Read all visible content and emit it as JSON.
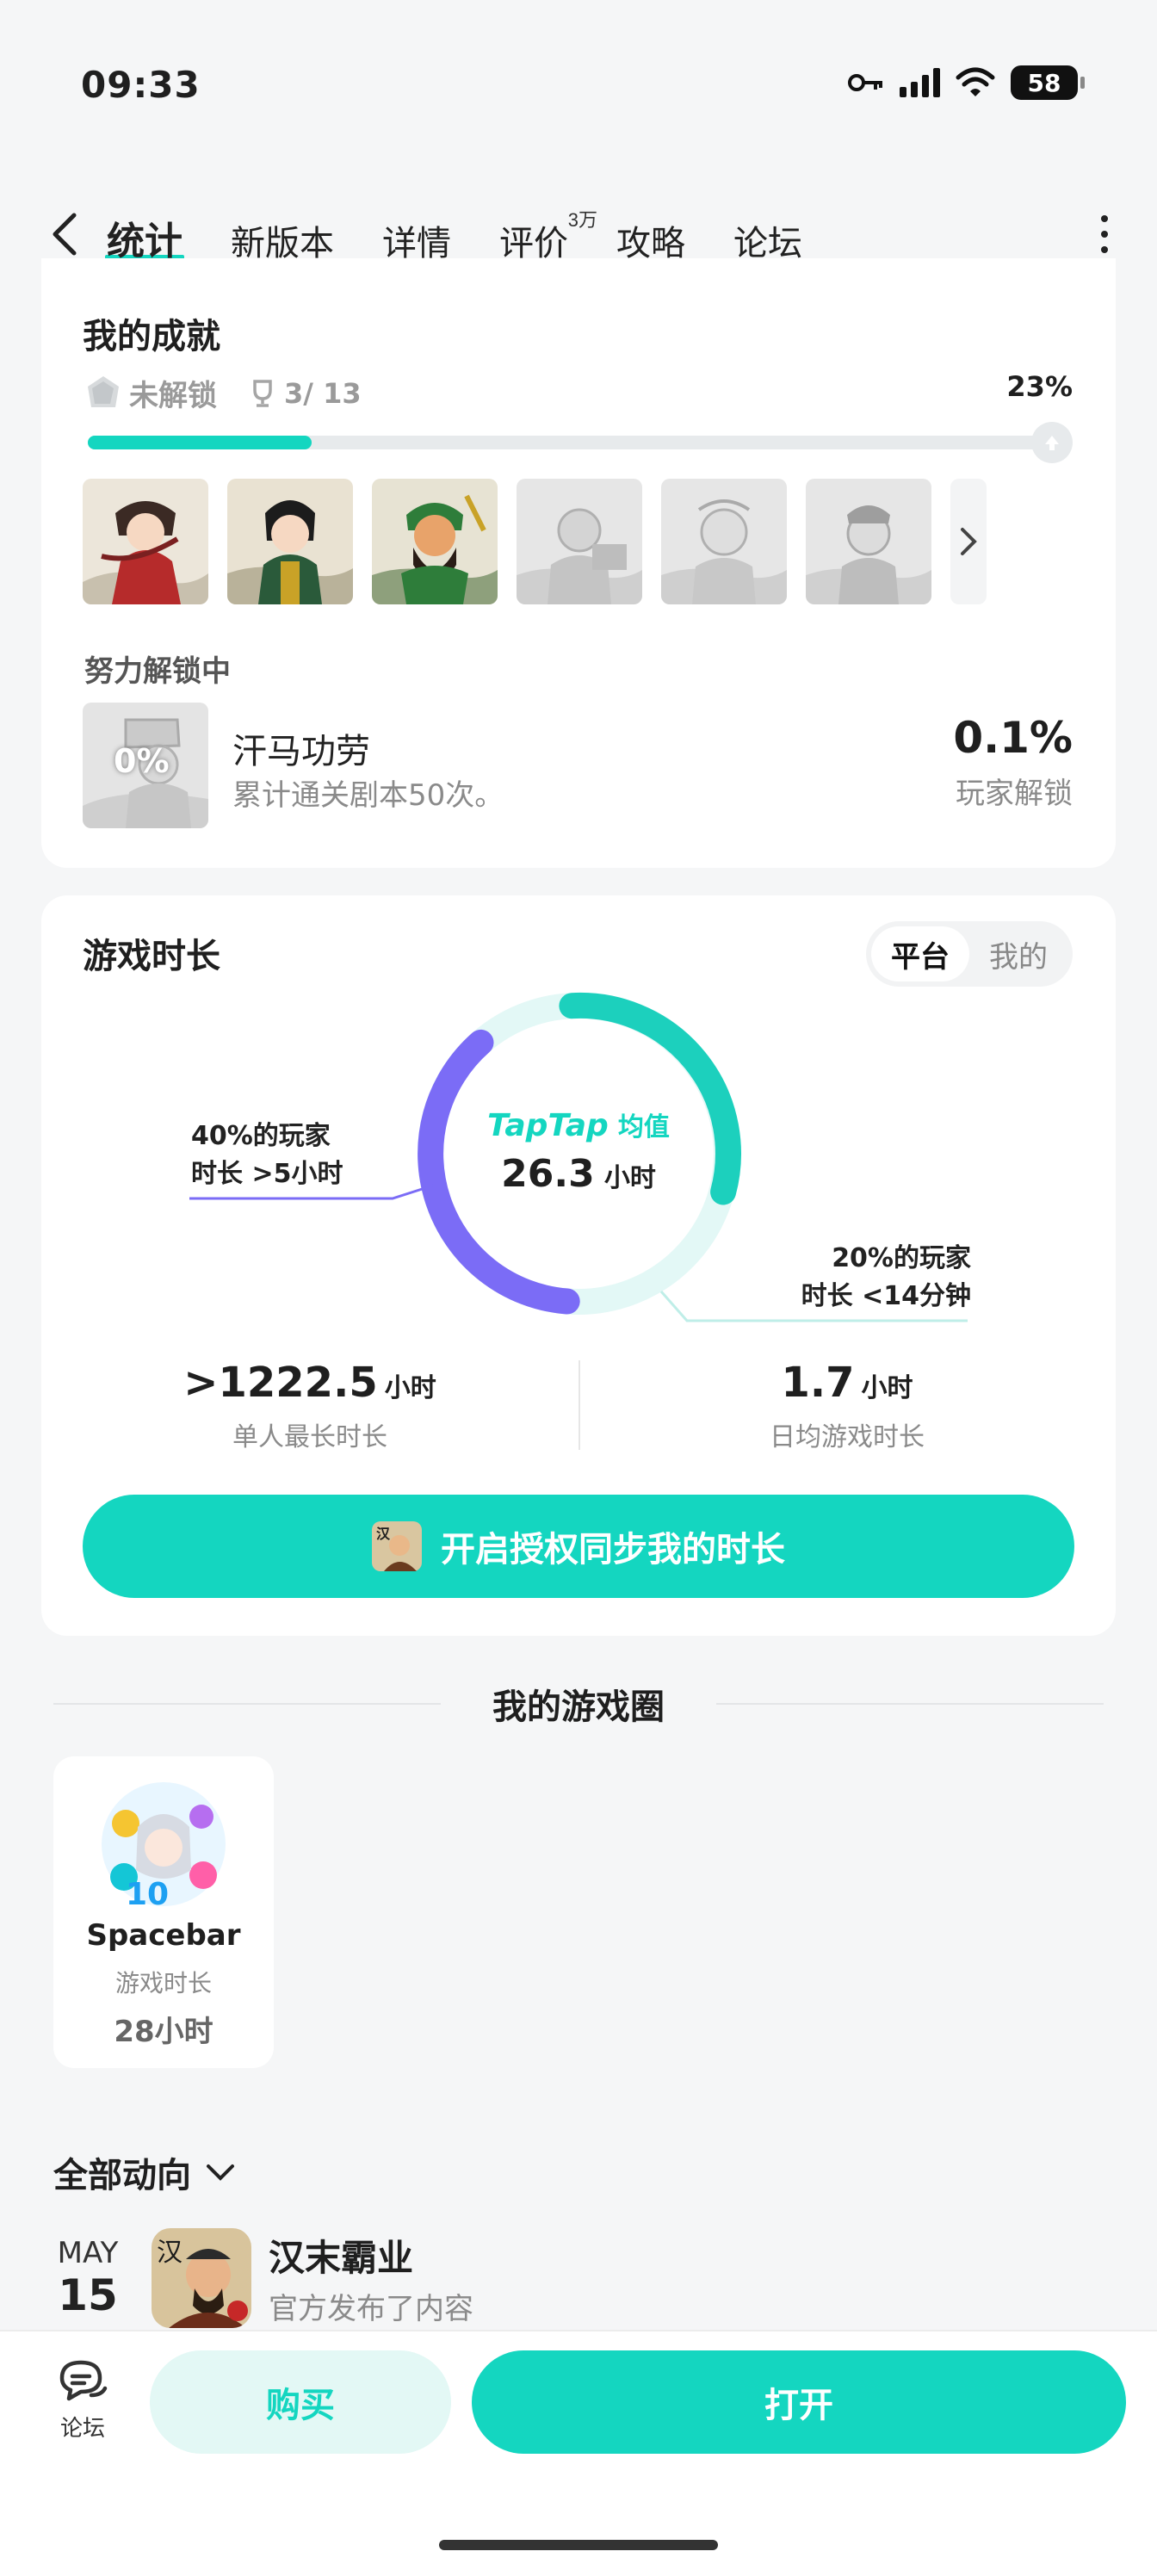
{
  "status_bar": {
    "time": "09:33",
    "battery": "58"
  },
  "tabs": [
    {
      "label": "统计",
      "active": true
    },
    {
      "label": "新版本"
    },
    {
      "label": "详情"
    },
    {
      "label": "评价",
      "badge": "3万"
    },
    {
      "label": "攻略"
    },
    {
      "label": "论坛"
    }
  ],
  "achievements": {
    "title": "我的成就",
    "status": "未解锁",
    "count": "3/ 13",
    "percent": "23%",
    "progress_fraction": 0.23,
    "in_progress_title": "努力解锁中",
    "current": {
      "badge_text": "0%",
      "name": "汗马功劳",
      "desc": "累计通关剧本50次。",
      "rate": "0.1%",
      "rate_label": "玩家解锁"
    }
  },
  "playtime": {
    "title": "游戏时长",
    "seg_platform": "平台",
    "seg_mine": "我的",
    "brand": "TapTap",
    "avg_label": "均值",
    "avg_value": "26.3",
    "avg_unit": "小时",
    "left_note_line1": "40%的玩家",
    "left_note_line2": "时长 >5小时",
    "right_note_line1": "20%的玩家",
    "right_note_line2": "时长 <14分钟",
    "stat1_value": ">1222.5",
    "stat1_unit": "小时",
    "stat1_label": "单人最长时长",
    "stat2_value": "1.7",
    "stat2_unit": "小时",
    "stat2_label": "日均游戏时长",
    "sync_button": "开启授权同步我的时长"
  },
  "game_circle": {
    "title": "我的游戏圈",
    "user_name": "Spacebar",
    "time_label": "游戏时长",
    "time_value": "28小时"
  },
  "feed": {
    "filter_label": "全部动向",
    "items": [
      {
        "month": "MAY",
        "day": "15",
        "title": "汉末霸业",
        "subtitle": "官方发布了内容"
      }
    ]
  },
  "bottom": {
    "forum_label": "论坛",
    "buy_label": "购买",
    "open_label": "打开"
  },
  "colors": {
    "accent": "#14d6c0",
    "purple": "#7b6cf6",
    "background": "#f5f6f7"
  }
}
